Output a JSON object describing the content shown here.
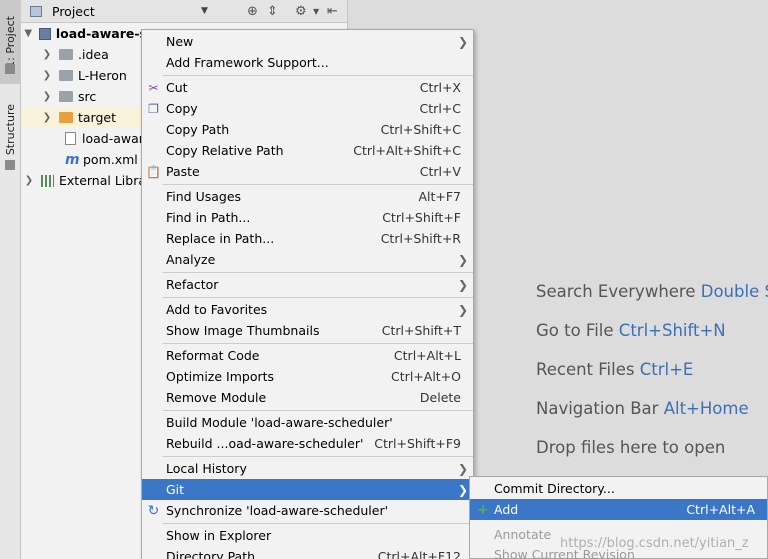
{
  "toolstrip": {
    "project_tab": "1: Project",
    "structure_tab": "Z: Structure"
  },
  "project_panel": {
    "title": "Project",
    "tree": [
      {
        "label": "load-aware-s",
        "type": "module"
      },
      {
        "label": ".idea",
        "type": "folder"
      },
      {
        "label": "L-Heron",
        "type": "folder"
      },
      {
        "label": "src",
        "type": "folder"
      },
      {
        "label": "target",
        "type": "folder-orange"
      },
      {
        "label": "load-awar",
        "type": "file"
      },
      {
        "label": "pom.xml",
        "type": "maven"
      },
      {
        "label": "External Libra",
        "type": "libraries"
      }
    ]
  },
  "editor_hints": [
    {
      "text": "Search Everywhere ",
      "key": "Double Shi"
    },
    {
      "text": "Go to File ",
      "key": "Ctrl+Shift+N"
    },
    {
      "text": "Recent Files ",
      "key": "Ctrl+E"
    },
    {
      "text": "Navigation Bar ",
      "key": "Alt+Home"
    },
    {
      "text": "Drop files here to open",
      "key": ""
    }
  ],
  "context_menu": {
    "items": [
      {
        "label": "New",
        "shortcut": "",
        "submenu": true
      },
      {
        "label": "Add Framework Support...",
        "shortcut": ""
      },
      {
        "label": "Cut",
        "shortcut": "Ctrl+X",
        "icon": "cut-icon"
      },
      {
        "label": "Copy",
        "shortcut": "Ctrl+C",
        "icon": "copy-icon"
      },
      {
        "label": "Copy Path",
        "shortcut": "Ctrl+Shift+C"
      },
      {
        "label": "Copy Relative Path",
        "shortcut": "Ctrl+Alt+Shift+C"
      },
      {
        "label": "Paste",
        "shortcut": "Ctrl+V",
        "icon": "paste-icon"
      },
      {
        "label": "Find Usages",
        "shortcut": "Alt+F7"
      },
      {
        "label": "Find in Path...",
        "shortcut": "Ctrl+Shift+F"
      },
      {
        "label": "Replace in Path...",
        "shortcut": "Ctrl+Shift+R"
      },
      {
        "label": "Analyze",
        "shortcut": "",
        "submenu": true
      },
      {
        "label": "Refactor",
        "shortcut": "",
        "submenu": true
      },
      {
        "label": "Add to Favorites",
        "shortcut": "",
        "submenu": true
      },
      {
        "label": "Show Image Thumbnails",
        "shortcut": "Ctrl+Shift+T"
      },
      {
        "label": "Reformat Code",
        "shortcut": "Ctrl+Alt+L"
      },
      {
        "label": "Optimize Imports",
        "shortcut": "Ctrl+Alt+O"
      },
      {
        "label": "Remove Module",
        "shortcut": "Delete"
      },
      {
        "label": "Build Module 'load-aware-scheduler'",
        "shortcut": ""
      },
      {
        "label": "Rebuild ...oad-aware-scheduler'",
        "shortcut": "Ctrl+Shift+F9"
      },
      {
        "label": "Local History",
        "shortcut": "",
        "submenu": true
      },
      {
        "label": "Git",
        "shortcut": "",
        "submenu": true,
        "active": true
      },
      {
        "label": "Synchronize 'load-aware-scheduler'",
        "shortcut": "",
        "icon": "sync-icon"
      },
      {
        "label": "Show in Explorer",
        "shortcut": ""
      },
      {
        "label": "Directory Path",
        "shortcut": "Ctrl+Alt+F12"
      }
    ]
  },
  "git_submenu": {
    "items": [
      {
        "label": "Commit Directory...",
        "shortcut": ""
      },
      {
        "label": "Add",
        "shortcut": "Ctrl+Alt+A",
        "active": true
      },
      {
        "label": "Annotate",
        "shortcut": "",
        "disabled": true
      },
      {
        "label": "Show Current Revision",
        "shortcut": "",
        "disabled": true
      }
    ]
  },
  "watermark": "https://blog.csdn.net/yitian_z",
  "colors": {
    "selection": "#3b77c6",
    "hint_key": "#3d6fb6",
    "folder_orange": "#e9a040"
  }
}
